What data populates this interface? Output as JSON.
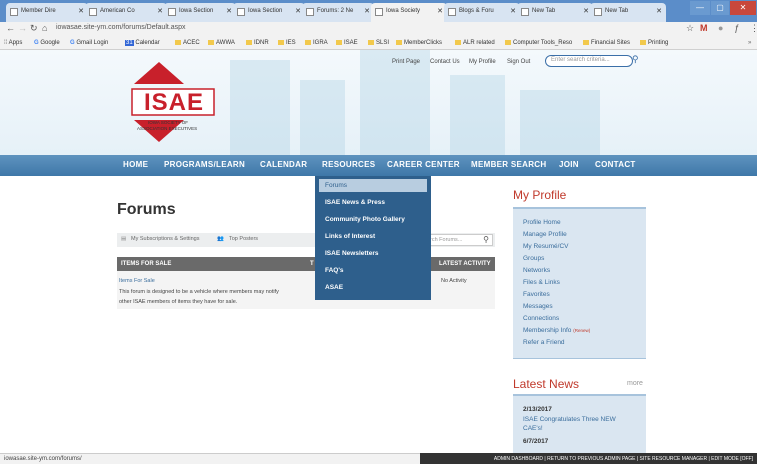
{
  "browser": {
    "tabs": [
      {
        "label": "Member Dire"
      },
      {
        "label": "American Co"
      },
      {
        "label": "Iowa Section"
      },
      {
        "label": "Iowa Section"
      },
      {
        "label": "Forums: 2 Ne"
      },
      {
        "label": "Iowa Society"
      },
      {
        "label": "Blogs & Foru"
      },
      {
        "label": "New Tab"
      },
      {
        "label": "New Tab"
      }
    ],
    "url": "iowasae.site-ym.com/forums/Default.aspx",
    "bookmarks": [
      "Apps",
      "Google",
      "Gmail Login",
      "Calendar",
      "ACEC",
      "AWWA",
      "IDNR",
      "IES",
      "IGRA",
      "ISAE",
      "SLSI",
      "MemberClicks",
      "ALR related",
      "Computer Tools_Reso",
      "Financial Sites",
      "Printing"
    ],
    "status_url": "iowasae.site-ym.com/forums/"
  },
  "header": {
    "top_links": [
      "Print Page",
      "Contact Us",
      "My Profile",
      "Sign Out"
    ],
    "search_placeholder": "Enter search criteria...",
    "logo_text": "ISAE",
    "logo_sub1": "IOWA SOCIETY OF",
    "logo_sub2": "ASSOCIATION EXECUTIVES"
  },
  "nav": [
    "HOME",
    "PROGRAMS/LEARN",
    "CALENDAR",
    "RESOURCES",
    "CAREER CENTER",
    "MEMBER SEARCH",
    "JOIN",
    "CONTACT"
  ],
  "dropdown": [
    "Forums",
    "ISAE News & Press",
    "Community Photo Gallery",
    "Links of Interest",
    "ISAE Newsletters",
    "FAQ's",
    "ASAE"
  ],
  "main": {
    "title": "Forums",
    "my_subscriptions": "My Subscriptions & Settings",
    "top_posters": "Top Posters",
    "search_forums": "rch Forums...",
    "col_items": "ITEMS FOR SALE",
    "col_t": "T",
    "col_latest": "LATEST ACTIVITY",
    "forum_name": "Items For Sale",
    "forum_desc1": "This forum is designed to be a vehicle where members may notify",
    "forum_desc2": "other ISAE members of items they have for sale.",
    "latest": "No Activity"
  },
  "sidebar": {
    "title": "My Profile",
    "links": [
      "Profile Home",
      "Manage Profile",
      "My Resumé/CV",
      "Groups",
      "Networks",
      "Files & Links",
      "Favorites",
      "Messages",
      "Connections",
      "Membership Info",
      "Refer a Friend"
    ],
    "renew": "(Renew)"
  },
  "news": {
    "title": "Latest News",
    "more": "more",
    "item1_date": "2/13/2017",
    "item1_l1": "ISAE Congratulates Three NEW",
    "item1_l2": "CAE's!",
    "item2_date": "6/7/2017"
  },
  "admin_bar": "ADMIN DASHBOARD | RETURN TO PREVIOUS ADMIN PAGE | SITE RESOURCE MANAGER | EDIT MODE [OFF]"
}
